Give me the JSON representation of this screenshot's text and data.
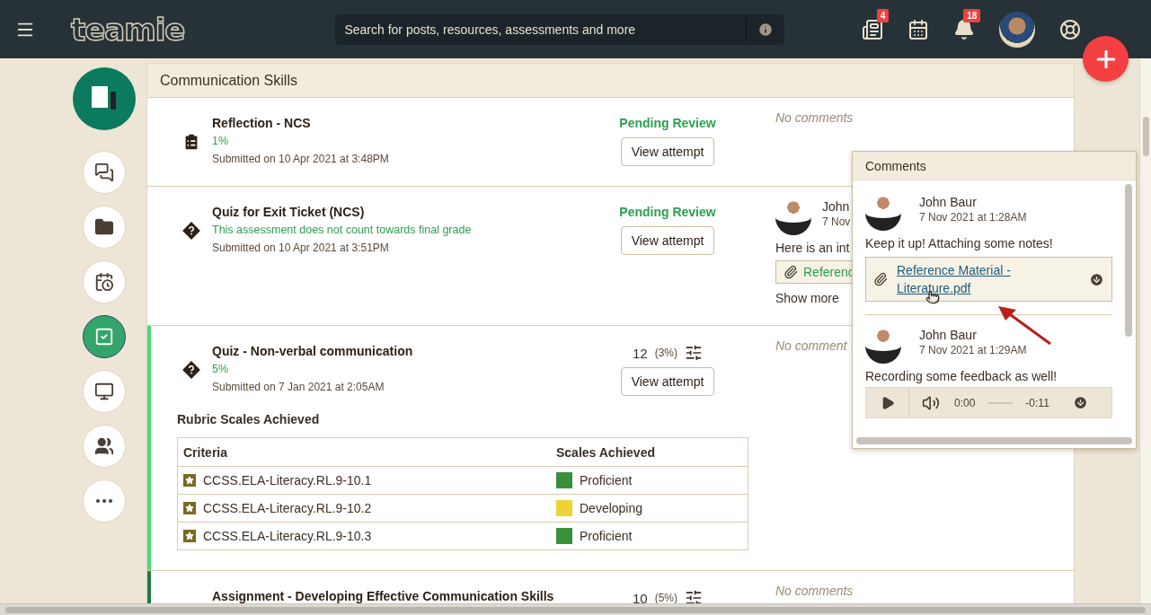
{
  "topbar": {
    "logo": "teamie",
    "search": {
      "placeholder": "Search for posts, resources, assessments and more"
    },
    "icons": [
      {
        "kind": "resources",
        "badge": "4"
      },
      {
        "kind": "calendar"
      },
      {
        "kind": "bell",
        "badge": "18"
      },
      {
        "kind": "avatar"
      },
      {
        "kind": "help"
      }
    ]
  },
  "sidebar": {
    "items": [
      {
        "kind": "discussion",
        "selected": false
      },
      {
        "kind": "folder",
        "selected": false
      },
      {
        "kind": "schedule",
        "selected": false
      },
      {
        "kind": "assessment",
        "selected": true
      },
      {
        "kind": "screen",
        "selected": false
      },
      {
        "kind": "people",
        "selected": false
      },
      {
        "kind": "more",
        "selected": false
      }
    ]
  },
  "section": {
    "title": "Communication Skills",
    "rows": [
      {
        "kind": "reflection",
        "title": "Reflection - NCS",
        "subtitle": "1%",
        "submitted": "Submitted on 10 Apr 2021 at 3:48PM",
        "status": "Pending Review",
        "button": "View attempt",
        "no_comments": "No comments"
      },
      {
        "kind": "quiz",
        "title": "Quiz for Exit Ticket (NCS)",
        "subtitle": "This assessment does not count towards final grade",
        "submitted": "Submitted on 10 Apr 2021 at 3:51PM",
        "status": "Pending Review",
        "button": "View attempt",
        "comment": {
          "author": "John",
          "date": "7 Nov",
          "text": "Here is an int",
          "attachment": "Referenc",
          "more": "Show more"
        }
      },
      {
        "kind": "quiz",
        "color": "#4cd97b",
        "title": "Quiz - Non-verbal communication",
        "subtitle": "5%",
        "submitted": "Submitted on 7 Jan 2021 at 2:05AM",
        "score": "12",
        "score_pct": "(3%)",
        "button": "View attempt",
        "no_comments": "No comment",
        "rubric": {
          "title": "Rubric Scales Achieved",
          "columns": [
            "Criteria",
            "Scales Achieved"
          ],
          "rows": [
            {
              "criterion": "CCSS.ELA-Literacy.RL.9-10.1",
              "scale": "Proficient",
              "color": "#3a8f3a"
            },
            {
              "criterion": "CCSS.ELA-Literacy.RL.9-10.2",
              "scale": "Developing",
              "color": "#efd23a"
            },
            {
              "criterion": "CCSS.ELA-Literacy.RL.9-10.3",
              "scale": "Proficient",
              "color": "#3a8f3a"
            }
          ]
        }
      },
      {
        "kind": "assignment",
        "color": "#1f7a44",
        "title": "Assignment - Developing Effective Communication Skills",
        "score": "10",
        "score_pct": "(5%)",
        "no_comments": "No comments"
      }
    ]
  },
  "comments_popover": {
    "title": "Comments",
    "comments": [
      {
        "kind": "file",
        "author": "John Baur",
        "date": "7 Nov 2021 at 1:28AM",
        "text": "Keep it up! Attaching some notes!",
        "attachment": "Reference Material - Literature.pdf"
      },
      {
        "kind": "audio",
        "author": "John Baur",
        "date": "7 Nov 2021 at 1:29AM",
        "text": "Recording some feedback as well!",
        "elapsed": "0:00",
        "remaining": "-0:11"
      }
    ]
  }
}
